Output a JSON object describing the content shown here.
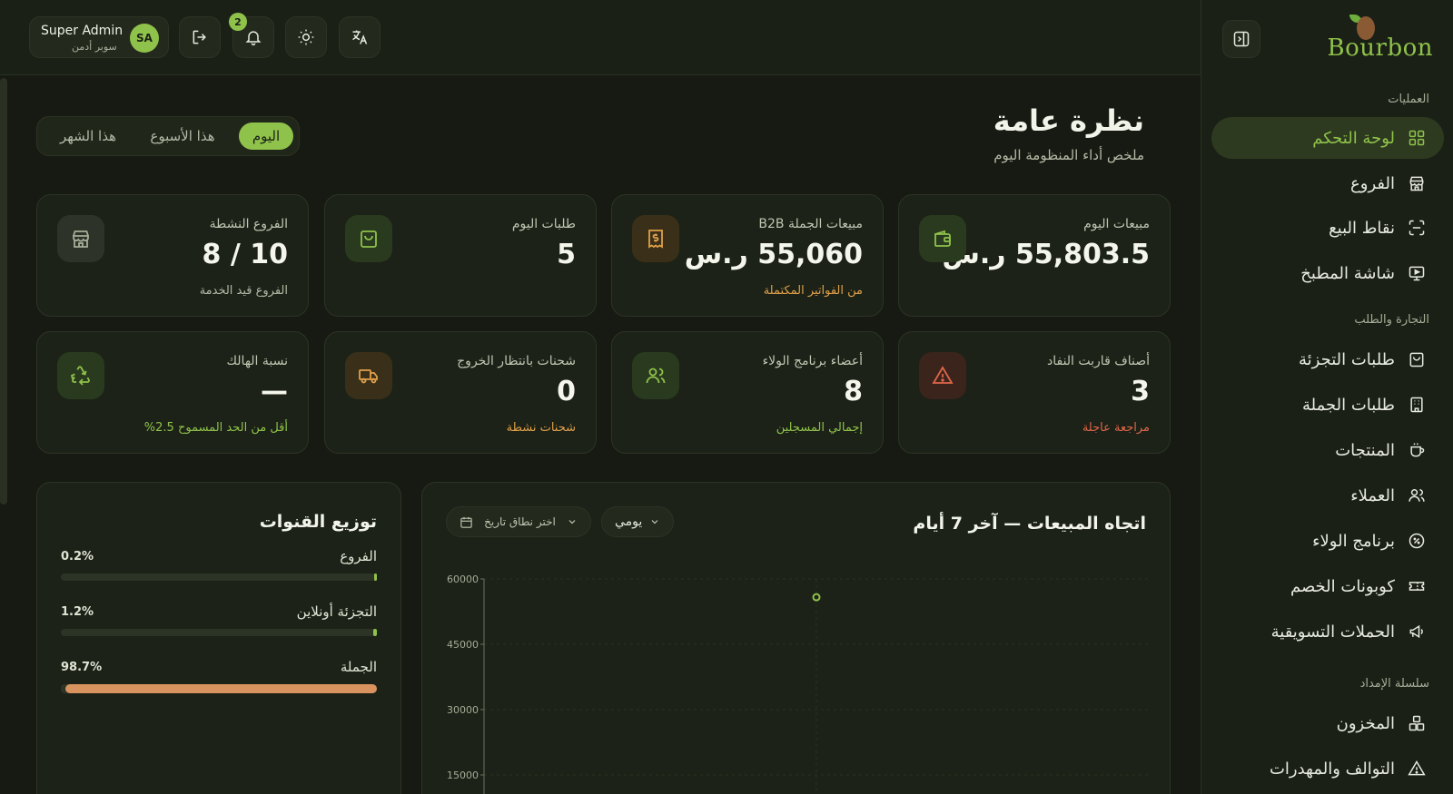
{
  "brand": {
    "name": "Bourbon"
  },
  "sidebar": {
    "sections": [
      {
        "title": "العمليات",
        "items": [
          {
            "label": "لوحة التحكم",
            "icon": "dashboard-grid-icon",
            "active": true
          },
          {
            "label": "الفروع",
            "icon": "store-icon"
          },
          {
            "label": "نقاط البيع",
            "icon": "scan-icon"
          },
          {
            "label": "شاشة المطبخ",
            "icon": "monitor-icon"
          }
        ]
      },
      {
        "title": "التجارة والطلب",
        "items": [
          {
            "label": "طلبات التجزئة",
            "icon": "bag-icon"
          },
          {
            "label": "طلبات الجملة",
            "icon": "building-icon"
          },
          {
            "label": "المنتجات",
            "icon": "cup-icon"
          },
          {
            "label": "العملاء",
            "icon": "users-icon"
          },
          {
            "label": "برنامج الولاء",
            "icon": "badge-percent-icon"
          },
          {
            "label": "كوبونات الخصم",
            "icon": "ticket-icon"
          },
          {
            "label": "الحملات التسويقية",
            "icon": "megaphone-icon"
          }
        ]
      },
      {
        "title": "سلسلة الإمداد",
        "items": [
          {
            "label": "المخزون",
            "icon": "boxes-icon"
          },
          {
            "label": "التوالف والمهدرات",
            "icon": "warning-icon"
          }
        ]
      }
    ]
  },
  "topbar": {
    "user": {
      "name": "Super Admin",
      "role": "سوبر أدمن",
      "initials": "SA"
    },
    "notifications_count": "2"
  },
  "header": {
    "title": "نظرة عامة",
    "subtitle": "ملخص أداء المنظومة اليوم",
    "range_tabs": [
      {
        "label": "اليوم",
        "active": true
      },
      {
        "label": "هذا الأسبوع"
      },
      {
        "label": "هذا الشهر"
      }
    ]
  },
  "stats": [
    {
      "label": "مبيعات اليوم",
      "value": "55,803.5 ر.س",
      "note": "",
      "icon": "wallet-icon",
      "tone": "green"
    },
    {
      "label": "مبيعات الجملة B2B",
      "value": "55,060 ر.س",
      "note": "من الفواتير المكتملة",
      "icon": "receipt-icon",
      "tone": "amber"
    },
    {
      "label": "طلبات اليوم",
      "value": "5",
      "note": "",
      "icon": "bag-icon",
      "tone": "green"
    },
    {
      "label": "الفروع النشطة",
      "value": "10 / 8",
      "note": "الفروع قيد الخدمة",
      "icon": "store-icon",
      "tone": "gray"
    },
    {
      "label": "أصناف قاربت النفاد",
      "value": "3",
      "note": "مراجعة عاجلة",
      "icon": "warning-icon",
      "tone": "red"
    },
    {
      "label": "أعضاء برنامج الولاء",
      "value": "8",
      "note": "إجمالي المسجلين",
      "icon": "users-icon",
      "tone": "green"
    },
    {
      "label": "شحنات بانتظار الخروج",
      "value": "0",
      "note": "شحنات نشطة",
      "icon": "truck-icon",
      "tone": "amber"
    },
    {
      "label": "نسبة الهالك",
      "value": "—",
      "note": "أقل من الحد المسموح 2.5%",
      "icon": "recycle-icon",
      "tone": "green"
    }
  ],
  "channels": {
    "title": "توزيع القنوات",
    "rows": [
      {
        "label": "الفروع",
        "pct": "0.2%",
        "value": 0.2,
        "color": "#8fc24a"
      },
      {
        "label": "التجزئة أونلاين",
        "pct": "1.2%",
        "value": 1.2,
        "color": "#8fc24a"
      },
      {
        "label": "الجملة",
        "pct": "98.7%",
        "value": 98.7,
        "color": "#d9935e"
      }
    ]
  },
  "sales_trend": {
    "title": "اتجاه المبيعات — آخر 7 أيام",
    "period_select": "يومي",
    "date_range_placeholder": "اختر نطاق تاريخ"
  },
  "chart_data": {
    "type": "line",
    "title": "اتجاه المبيعات — آخر 7 أيام",
    "xlabel": "",
    "ylabel": "",
    "ylim": [
      0,
      60000
    ],
    "yticks": [
      60000,
      45000,
      30000,
      15000
    ],
    "yticks_labels": [
      "60000",
      "45000",
      "30000",
      "15000"
    ],
    "grid": true,
    "series": [
      {
        "values": [
          55803.5
        ]
      }
    ]
  },
  "colors": {
    "accent": "#8fc24a",
    "amber": "#e0a04a",
    "danger": "#e0664a",
    "background": "#161a12"
  }
}
